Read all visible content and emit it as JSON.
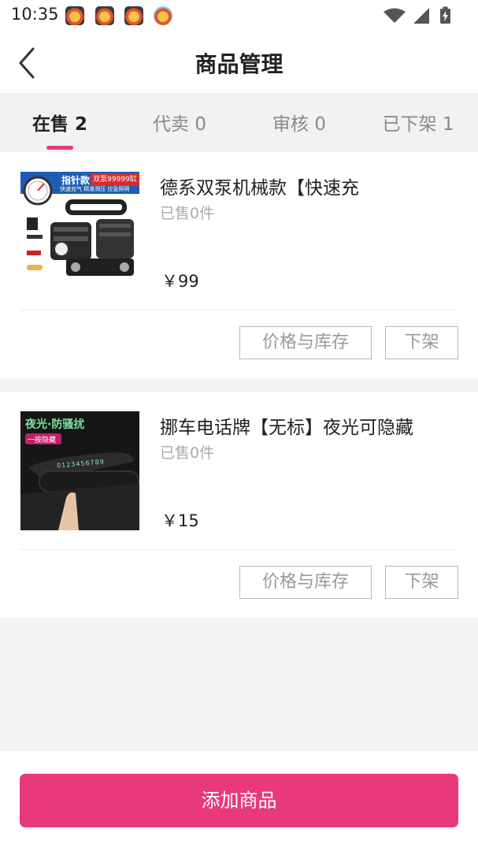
{
  "status_bar": {
    "time": "10:35",
    "app_icons": [
      "lion-app-icon",
      "lion-app-icon",
      "lion-app-icon",
      "lion-app-icon"
    ],
    "indicators": [
      "wifi-icon",
      "signal-icon",
      "battery-charging-icon"
    ]
  },
  "nav": {
    "title": "商品管理",
    "back_icon": "chevron-left-icon"
  },
  "tabs": [
    {
      "label": "在售 2",
      "active": true
    },
    {
      "label": "代卖 0",
      "active": false
    },
    {
      "label": "审核 0",
      "active": false
    },
    {
      "label": "已下架 1",
      "active": false
    }
  ],
  "colors": {
    "accent": "#e8397a",
    "page_bg": "#f3f3f3",
    "card_bg": "#ffffff"
  },
  "products": [
    {
      "name": "德系双泵机械款【快速充",
      "sold": "已售0件",
      "price": "￥99",
      "price_label": "价格与库存",
      "delist_label": "下架",
      "thumb": {
        "banner_text": "指针款",
        "badge_text": "双泵99999缸",
        "sub_text": "快速充气 精准测压 应急照明"
      }
    },
    {
      "name": "挪车电话牌【无标】夜光可隐藏",
      "sold": "已售0件",
      "price": "￥15",
      "price_label": "价格与库存",
      "delist_label": "下架",
      "thumb": {
        "headline": "夜光·防骚扰",
        "tag": "一按隐藏",
        "digits": "0123456789"
      }
    }
  ],
  "bottom": {
    "add_label": "添加商品"
  }
}
